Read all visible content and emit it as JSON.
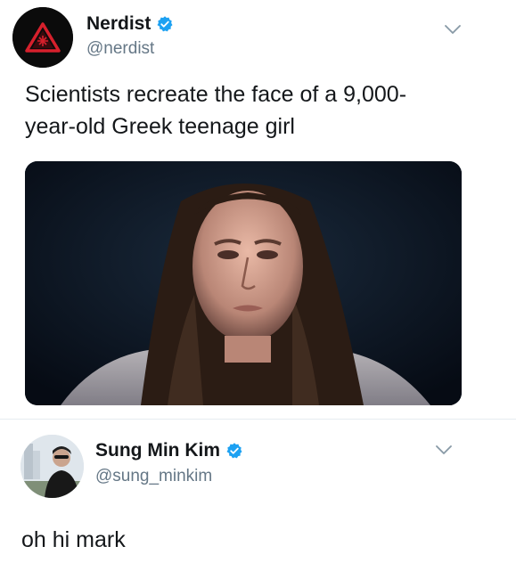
{
  "tweets": [
    {
      "display_name": "Nerdist",
      "handle": "@nerdist",
      "verified": true,
      "text": "Scientists recreate the face of a 9,000-year-old Greek teenage girl",
      "text_line1": "Scientists recreate the face of a 9,000-",
      "text_line2": "year-old Greek teenage girl",
      "avatar_icon": "nerdist-logo-icon",
      "media": "reconstructed-face-photo"
    },
    {
      "display_name": "Sung Min Kim",
      "handle": "@sung_minkim",
      "verified": true,
      "text": "oh hi mark",
      "avatar_icon": "user-avatar-photo"
    }
  ],
  "colors": {
    "verified_blue": "#1da1f2",
    "handle_gray": "#657786",
    "text": "#14171a",
    "nerdist_red": "#d6202c"
  },
  "icons": [
    "verified-badge-icon",
    "chevron-down-icon",
    "nerdist-logo-icon"
  ]
}
